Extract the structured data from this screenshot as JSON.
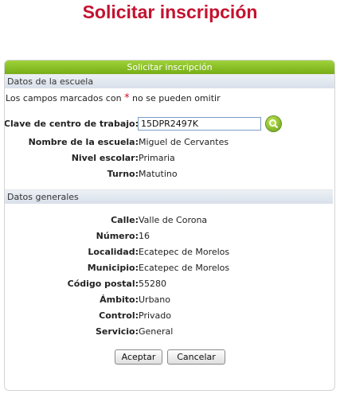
{
  "page_title": "Solicitar inscripción",
  "panel": {
    "header": "Solicitar inscripción",
    "section_school": "Datos de la escuela",
    "required_note_before": "Los campos marcados con ",
    "required_star": "*",
    "required_note_after": " no se pueden omitir",
    "section_general": "Datos generales"
  },
  "school": {
    "code_star": "*",
    "code_label": "Clave de centro de trabajo:",
    "code_value": "15DPR2497K",
    "name_label": "Nombre de la escuela:",
    "name_value": "Miguel de Cervantes",
    "level_label": "Nivel escolar:",
    "level_value": "Primaria",
    "shift_label": "Turno:",
    "shift_value": "Matutino"
  },
  "general": {
    "street_label": "Calle:",
    "street_value": "Valle de Corona",
    "number_label": "Número:",
    "number_value": "16",
    "locality_label": "Localidad:",
    "locality_value": "Ecatepec de Morelos",
    "municipality_label": "Municipio:",
    "municipality_value": "Ecatepec de Morelos",
    "postal_label": "Código postal:",
    "postal_value": "55280",
    "scope_label": "Ámbito:",
    "scope_value": "Urbano",
    "control_label": "Control:",
    "control_value": "Privado",
    "service_label": "Servicio:",
    "service_value": "General"
  },
  "buttons": {
    "accept": "Aceptar",
    "cancel": "Cancelar"
  },
  "colors": {
    "title": "#c41230",
    "header_green": "#8cc12a",
    "required": "#d01020"
  },
  "icons": {
    "search": "search-icon"
  }
}
